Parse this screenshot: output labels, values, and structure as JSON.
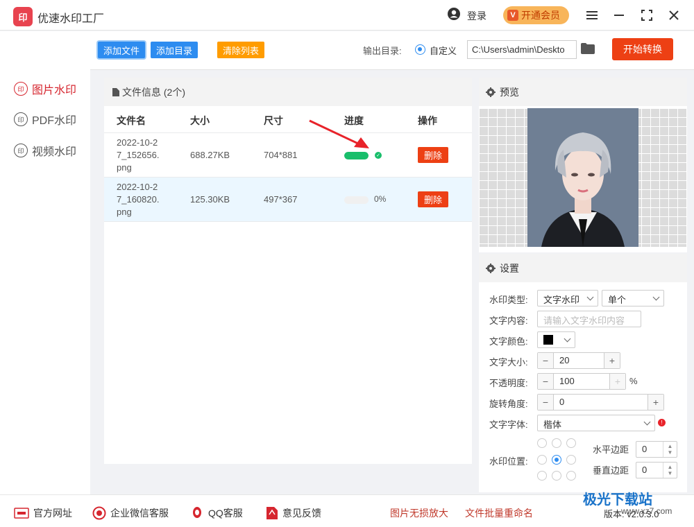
{
  "titlebar": {
    "logo_text": "印",
    "app_title": "优速水印工厂",
    "login": "登录",
    "vip_icon": "V",
    "vip": "开通会员",
    "icons": [
      "user-icon",
      "menu-icon",
      "minimize-icon",
      "maximize-icon",
      "close-icon"
    ]
  },
  "nav": {
    "items": [
      {
        "icon": "印",
        "label": "图片水印",
        "active": true
      },
      {
        "icon": "印",
        "label": "PDF水印",
        "active": false
      },
      {
        "icon": "印",
        "label": "视频水印",
        "active": false
      }
    ]
  },
  "toolbar": {
    "add_file": "添加文件",
    "add_folder": "添加目录",
    "clear_list": "清除列表",
    "output_label": "输出目录:",
    "output_option": "自定义",
    "output_path": "C:\\Users\\admin\\Deskto",
    "start": "开始转换"
  },
  "files": {
    "header": "文件信息 (2个)",
    "columns": [
      "文件名",
      "大小",
      "尺寸",
      "进度",
      "操作"
    ],
    "rows": [
      {
        "name": "2022-10-27_152656.png",
        "name_lines": [
          "2022-10-2",
          "7_152656.",
          "png"
        ],
        "size": "688.27KB",
        "dims": "704*881",
        "progress": 1.0,
        "progress_text": "",
        "action": "删除"
      },
      {
        "name": "2022-10-27_160820.png",
        "name_lines": [
          "2022-10-2",
          "7_160820.",
          "png"
        ],
        "size": "125.30KB",
        "dims": "497*367",
        "progress": 0.0,
        "progress_text": "0%",
        "action": "删除"
      }
    ]
  },
  "preview": {
    "header": "预览"
  },
  "settings": {
    "header": "设置",
    "wm_type_label": "水印类型:",
    "wm_type": "文字水印",
    "wm_mode": "单个",
    "text_label": "文字内容:",
    "text_placeholder": "请输入文字水印内容",
    "color_label": "文字颜色:",
    "color": "#000000",
    "size_label": "文字大小:",
    "size": "20",
    "opacity_label": "不透明度:",
    "opacity": "100",
    "opacity_unit": "%",
    "rotate_label": "旋转角度:",
    "rotate": "0",
    "font_label": "文字字体:",
    "font": "楷体",
    "position_label": "水印位置:",
    "position_selected": "center",
    "h_margin_label": "水平边距",
    "h_margin": "0",
    "v_margin_label": "垂直边距",
    "v_margin": "0"
  },
  "footer": {
    "website": "官方网址",
    "wechat": "企业微信客服",
    "qq": "QQ客服",
    "feedback": "意见反馈",
    "enlarge": "图片无损放大",
    "rename": "文件批量重命名",
    "version": "版本: v2.0.3.0"
  },
  "watermark": {
    "logo": "极光下载站",
    "url": "www.xz7.com"
  },
  "colors": {
    "accent_blue": "#2d8cf0",
    "danger_red": "#ed4014",
    "success_green": "#19be6b",
    "clear_orange": "#ff9c00",
    "nav_active": "#d6262f"
  }
}
